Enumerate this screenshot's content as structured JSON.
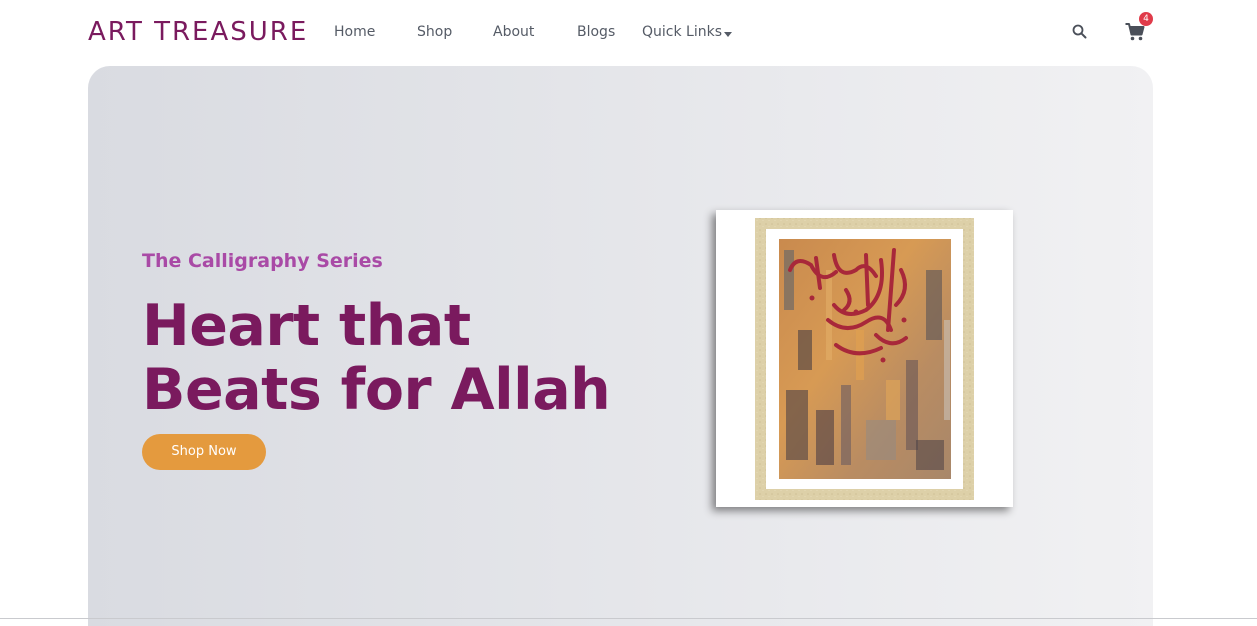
{
  "brand": {
    "logo_text": "ART TREASURE",
    "color": "#7a1a5e"
  },
  "nav": {
    "items": [
      {
        "label": "Home"
      },
      {
        "label": "Shop"
      },
      {
        "label": "About"
      },
      {
        "label": "Blogs"
      },
      {
        "label": "Quick Links",
        "has_dropdown": true
      }
    ]
  },
  "header_actions": {
    "search_icon": "search-icon",
    "cart_icon": "cart-icon",
    "cart_count": "4"
  },
  "hero": {
    "subtitle": "The Calligraphy Series",
    "headline_line1": "Heart that",
    "headline_line2": "Beats for Allah",
    "cta_label": "Shop Now",
    "artwork": "framed-calligraphy-painting"
  },
  "colors": {
    "accent": "#e49a3e",
    "subtitle": "#a94aa6",
    "headline": "#7a1a5e",
    "badge": "#e03b4a"
  }
}
